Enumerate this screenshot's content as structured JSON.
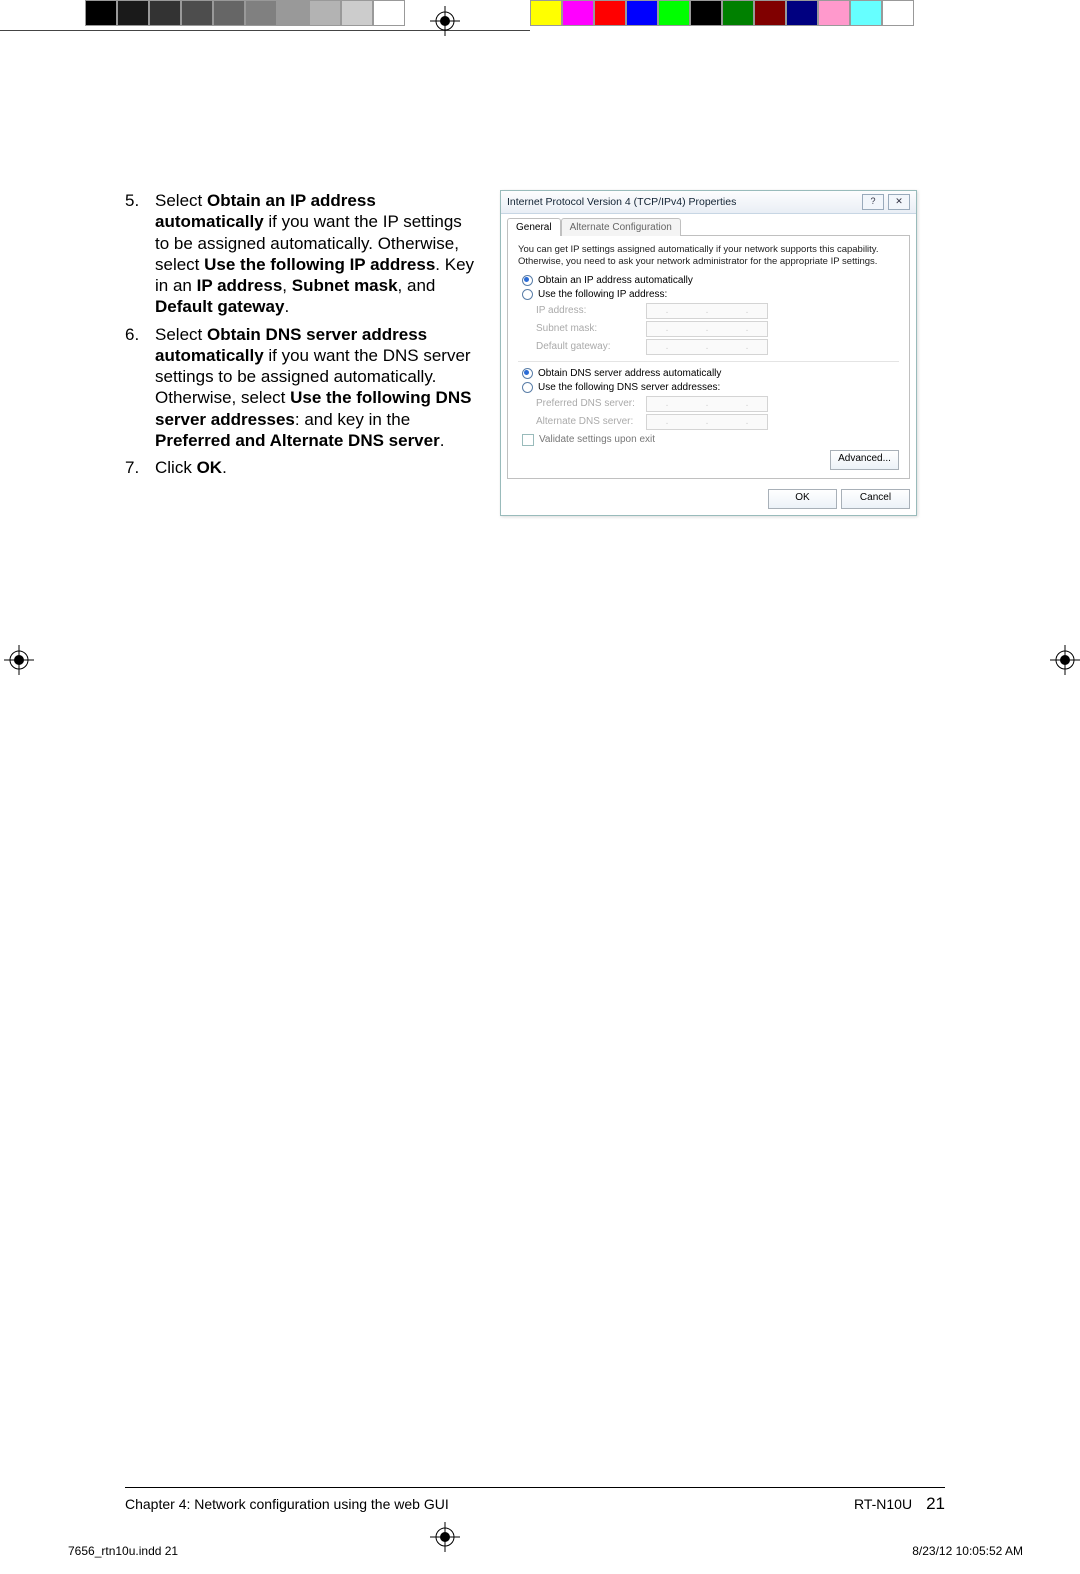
{
  "calibration": {
    "gray_swatches": [
      "#000000",
      "#1a1a1a",
      "#333333",
      "#4d4d4d",
      "#666666",
      "#808080",
      "#999999",
      "#b3b3b3",
      "#cccccc",
      "#ffffff"
    ],
    "color_swatches": [
      "#ffff00",
      "#ff00ff",
      "#ff0000",
      "#0000ff",
      "#00ff00",
      "#000000",
      "#008000",
      "#800000",
      "#000080",
      "#ff99cc",
      "#66ffff",
      "#ffffff"
    ]
  },
  "steps": {
    "s5": {
      "num": "5.",
      "a": "Select ",
      "b1": "Obtain an IP address automatically",
      "c": " if you want the IP settings to be assigned automatically. Otherwise, select ",
      "b2": "Use the following IP address",
      "d": ". Key in an ",
      "b3": "IP address",
      "e": ", ",
      "b4": "Subnet mask",
      "f": ", and ",
      "b5": "Default gateway",
      "g": "."
    },
    "s6": {
      "num": "6.",
      "a": "Select ",
      "b1": "Obtain DNS server address automatically",
      "c": " if you want the DNS server settings to be assigned automatically. Otherwise, select ",
      "b2": "Use the following DNS server addresses",
      "d": ": and key in the ",
      "b3": "Preferred and Alternate DNS server",
      "e": "."
    },
    "s7": {
      "num": "7.",
      "a": "Click ",
      "b1": "OK",
      "c": "."
    }
  },
  "dialog": {
    "title": "Internet Protocol Version 4 (TCP/IPv4) Properties",
    "help_icon": "?",
    "close_icon": "✕",
    "tabs": {
      "general": "General",
      "alt": "Alternate Configuration"
    },
    "desc": "You can get IP settings assigned automatically if your network supports this capability. Otherwise, you need to ask your network administrator for the appropriate IP settings.",
    "radio_ip_auto": "Obtain an IP address automatically",
    "radio_ip_manual": "Use the following IP address:",
    "lbl_ip": "IP address:",
    "lbl_mask": "Subnet mask:",
    "lbl_gw": "Default gateway:",
    "radio_dns_auto": "Obtain DNS server address automatically",
    "radio_dns_manual": "Use the following DNS server addresses:",
    "lbl_pdns": "Preferred DNS server:",
    "lbl_adns": "Alternate DNS server:",
    "chk_validate": "Validate settings upon exit",
    "btn_adv": "Advanced...",
    "btn_ok": "OK",
    "btn_cancel": "Cancel",
    "ip_placeholder": ". . ."
  },
  "footer": {
    "chapter": "Chapter 4: Network configuration using the web GUI",
    "model": "RT-N10U",
    "page": "21"
  },
  "slug": {
    "left": "7656_rtn10u.indd   21",
    "right": "8/23/12   10:05:52 AM"
  }
}
